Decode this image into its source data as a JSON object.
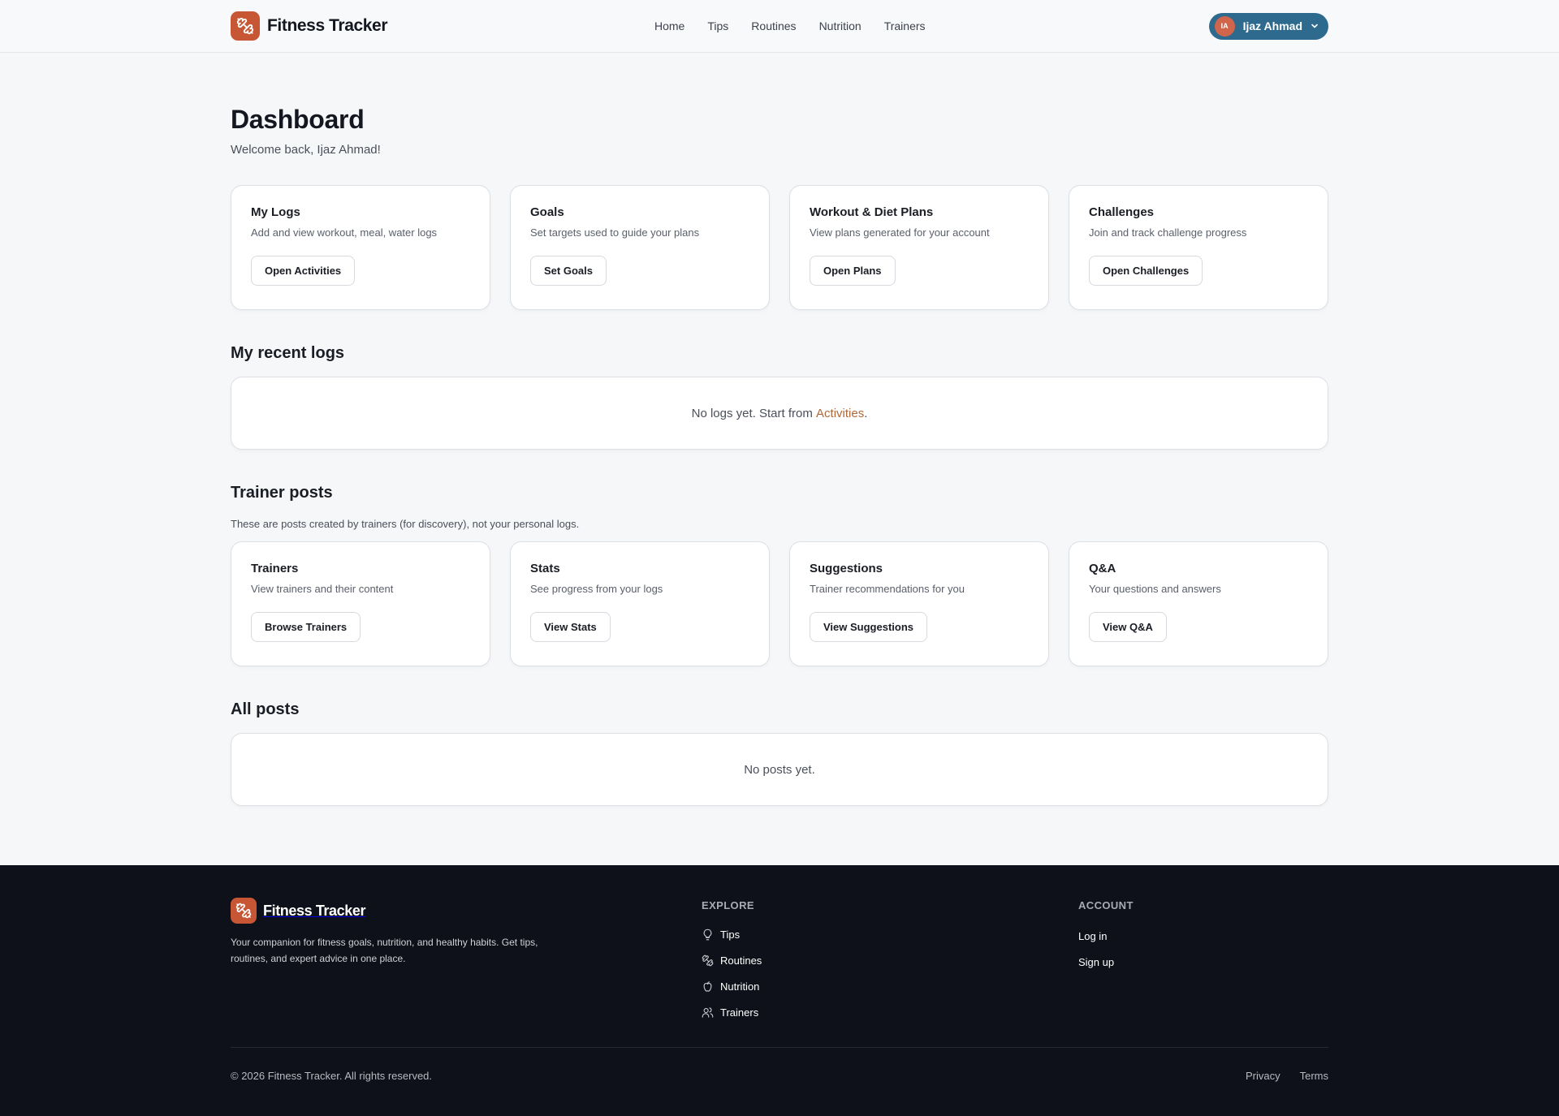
{
  "brand": {
    "name": "Fitness Tracker",
    "logo_icon": "dumbbell-icon",
    "logo_color": "#c75734"
  },
  "nav": {
    "items": [
      "Home",
      "Tips",
      "Routines",
      "Nutrition",
      "Trainers"
    ]
  },
  "user": {
    "initials": "IA",
    "name": "Ijaz Ahmad",
    "pill_color": "#2e6a8e"
  },
  "dashboard": {
    "title": "Dashboard",
    "welcome": "Welcome back, Ijaz Ahmad!",
    "cards": [
      {
        "title": "My Logs",
        "desc": "Add and view workout, meal, water logs",
        "button": "Open Activities"
      },
      {
        "title": "Goals",
        "desc": "Set targets used to guide your plans",
        "button": "Set Goals"
      },
      {
        "title": "Workout & Diet Plans",
        "desc": "View plans generated for your account",
        "button": "Open Plans"
      },
      {
        "title": "Challenges",
        "desc": "Join and track challenge progress",
        "button": "Open Challenges"
      }
    ]
  },
  "recent_logs": {
    "heading": "My recent logs",
    "empty_prefix": "No logs yet. Start from ",
    "empty_link": "Activities",
    "empty_suffix": "."
  },
  "trainer_posts": {
    "heading": "Trainer posts",
    "note": "These are posts created by trainers (for discovery), not your personal logs.",
    "cards": [
      {
        "title": "Trainers",
        "desc": "View trainers and their content",
        "button": "Browse Trainers"
      },
      {
        "title": "Stats",
        "desc": "See progress from your logs",
        "button": "View Stats"
      },
      {
        "title": "Suggestions",
        "desc": "Trainer recommendations for you",
        "button": "View Suggestions"
      },
      {
        "title": "Q&A",
        "desc": "Your questions and answers",
        "button": "View Q&A"
      }
    ]
  },
  "all_posts": {
    "heading": "All posts",
    "empty": "No posts yet."
  },
  "footer": {
    "brand": "Fitness Tracker",
    "description": "Your companion for fitness goals, nutrition, and healthy habits. Get tips, routines, and expert advice in one place.",
    "explore": {
      "heading": "EXPLORE",
      "items": [
        {
          "label": "Tips",
          "icon": "lightbulb-icon"
        },
        {
          "label": "Routines",
          "icon": "dumbbell-icon"
        },
        {
          "label": "Nutrition",
          "icon": "apple-icon"
        },
        {
          "label": "Trainers",
          "icon": "users-icon"
        }
      ]
    },
    "account": {
      "heading": "ACCOUNT",
      "items": [
        "Log in",
        "Sign up"
      ]
    },
    "copyright": "© 2026 Fitness Tracker. All rights reserved.",
    "links": [
      "Privacy",
      "Terms"
    ]
  }
}
